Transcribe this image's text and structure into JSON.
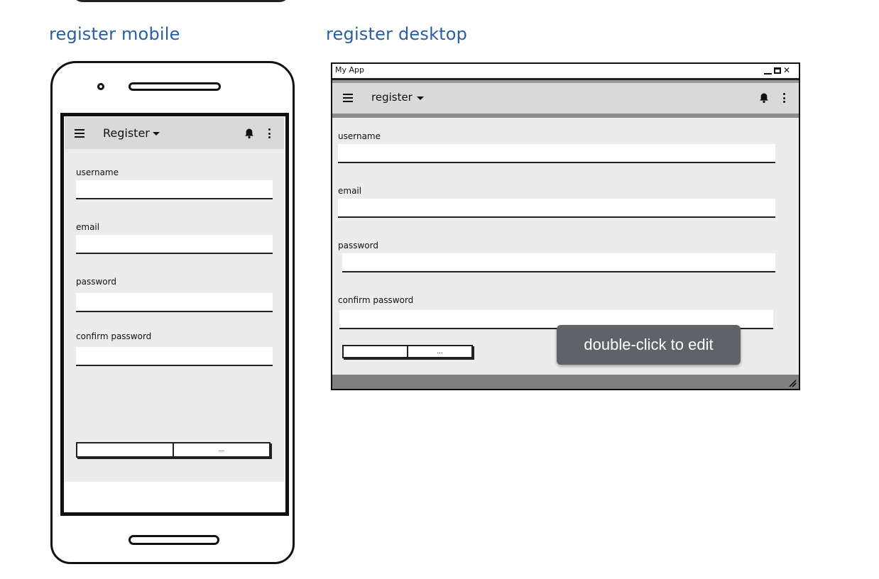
{
  "labels": {
    "mobile_title": "register mobile",
    "desktop_title": "register desktop"
  },
  "mobile": {
    "toolbar": {
      "title": "Register",
      "menu_icon": "hamburger-icon",
      "dropdown_icon": "caret-down-icon",
      "notification_icon": "bell-icon",
      "more_icon": "kebab-icon"
    },
    "form": {
      "fields": [
        {
          "label": "username",
          "value": ""
        },
        {
          "label": "email",
          "value": ""
        },
        {
          "label": "password",
          "value": ""
        },
        {
          "label": "confirm password",
          "value": ""
        }
      ],
      "buttons": [
        "",
        "..."
      ]
    }
  },
  "desktop": {
    "window_title": "My App",
    "window_controls": [
      "minimize-icon",
      "maximize-icon",
      "close-icon"
    ],
    "toolbar": {
      "title": "register",
      "menu_icon": "hamburger-icon",
      "dropdown_icon": "caret-down-icon",
      "notification_icon": "bell-icon",
      "more_icon": "kebab-icon"
    },
    "form": {
      "fields": [
        {
          "label": "username",
          "value": ""
        },
        {
          "label": "email",
          "value": ""
        },
        {
          "label": "password",
          "value": ""
        },
        {
          "label": "confirm password",
          "value": ""
        }
      ],
      "buttons": [
        "",
        "..."
      ]
    }
  },
  "tooltip": {
    "text": "double-click to edit"
  },
  "colors": {
    "heading": "#2a5ea3",
    "toolbar_bg": "#d9d9d9",
    "content_bg": "#ececec",
    "status_bar": "#808080",
    "tooltip_bg": "#5f6368"
  }
}
